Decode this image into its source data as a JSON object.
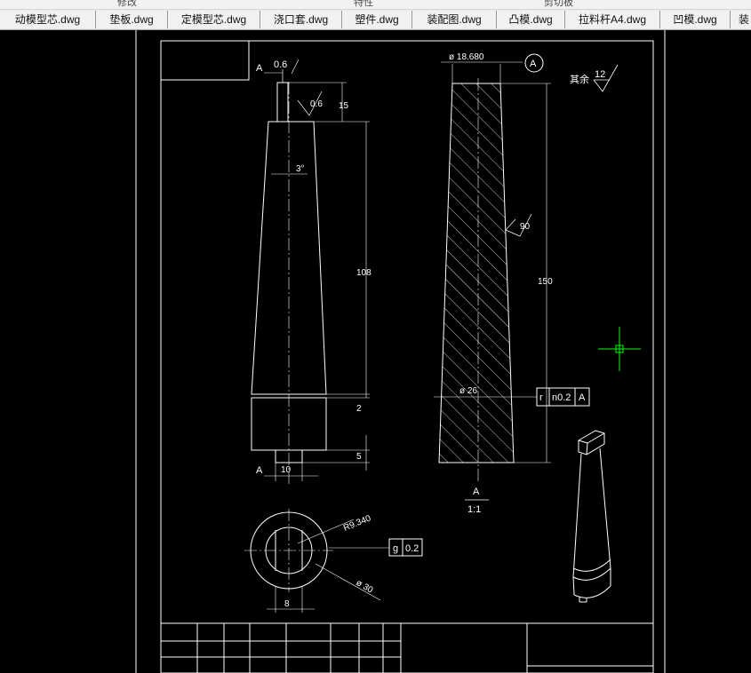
{
  "ribbon_labels": [
    "修改",
    "特性",
    "剪切板"
  ],
  "tabs": [
    {
      "label": "动模型芯.dwg"
    },
    {
      "label": "垫板.dwg"
    },
    {
      "label": "定模型芯.dwg"
    },
    {
      "label": "浇口套.dwg"
    },
    {
      "label": "塑件.dwg"
    },
    {
      "label": "装配图.dwg"
    },
    {
      "label": "凸模.dwg"
    },
    {
      "label": "拉料杆A4.dwg"
    },
    {
      "label": "凹模.dwg"
    },
    {
      "label": "装"
    }
  ],
  "drawing": {
    "colors": {
      "background": "#000000",
      "lines": "#ffffff",
      "cursor": "#00ff00"
    },
    "left_view": {
      "section_mark_top": "A",
      "section_mark_bottom": "A",
      "dim_top_width": "0.6",
      "dim_head_height": "15",
      "dim_surface_roughness": "0.6",
      "dim_taper_angle": "3°",
      "dim_total_length": "108",
      "dim_step": "2",
      "dim_base": "5",
      "dim_bottom_width": "10"
    },
    "right_view": {
      "dim_top_diameter": "ø 18.680",
      "datum_circle": "A",
      "dim_roughness": "90",
      "dim_height": "150",
      "dim_bottom_diameter": "ø 26",
      "tolerance_symbol": "r",
      "tolerance_value": "n0.2",
      "tolerance_datum": "A",
      "section_label": "A",
      "section_scale": "1:1"
    },
    "remaining_note": {
      "label": "其余",
      "value": "12"
    },
    "plan_view": {
      "dim_radius": "R9.340",
      "dim_diameter": "ø 30",
      "dim_width": "8",
      "tolerance_symbol": "g",
      "tolerance_value": "0.2"
    }
  }
}
